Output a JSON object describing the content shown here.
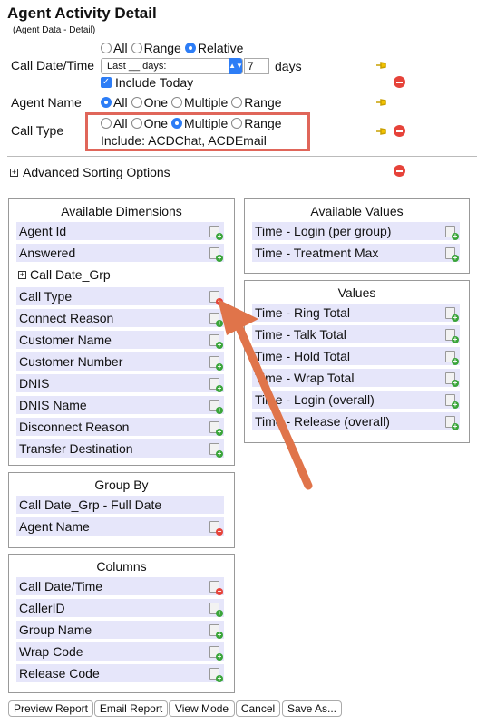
{
  "page": {
    "title": "Agent Activity Detail",
    "subtitle": "(Agent Data - Detail)"
  },
  "call_datetime": {
    "label": "Call Date/Time",
    "options": [
      "All",
      "Range",
      "Relative"
    ],
    "selected": "Relative",
    "dropdown_value": "Last __ days:",
    "days_value": "7",
    "days_unit": "days",
    "include_today_label": "Include Today",
    "include_today_checked": true
  },
  "agent_name": {
    "label": "Agent Name",
    "options": [
      "All",
      "One",
      "Multiple",
      "Range"
    ],
    "selected": "All"
  },
  "call_type": {
    "label": "Call Type",
    "options": [
      "All",
      "One",
      "Multiple",
      "Range"
    ],
    "selected": "Multiple",
    "include_text": "Include: ACDChat, ACDEmail"
  },
  "advanced_sorting": {
    "label": "Advanced Sorting Options"
  },
  "available_dimensions": {
    "title": "Available Dimensions",
    "items": [
      {
        "label": "Agent Id",
        "action": "add"
      },
      {
        "label": "Answered",
        "action": "add"
      },
      {
        "label": "Call Date_Grp",
        "action": "expand"
      },
      {
        "label": "Call Type",
        "action": "remove"
      },
      {
        "label": "Connect Reason",
        "action": "add"
      },
      {
        "label": "Customer Name",
        "action": "add"
      },
      {
        "label": "Customer Number",
        "action": "add"
      },
      {
        "label": "DNIS",
        "action": "add"
      },
      {
        "label": "DNIS Name",
        "action": "add"
      },
      {
        "label": "Disconnect Reason",
        "action": "add"
      },
      {
        "label": "Transfer Destination",
        "action": "add"
      }
    ]
  },
  "available_values": {
    "title": "Available Values",
    "items": [
      {
        "label": "Time - Login (per group)",
        "action": "add"
      },
      {
        "label": "Time - Treatment Max",
        "action": "add"
      }
    ]
  },
  "values": {
    "title": "Values",
    "items": [
      {
        "label": "Time - Ring Total",
        "action": "add"
      },
      {
        "label": "Time - Talk Total",
        "action": "add"
      },
      {
        "label": "Time - Hold Total",
        "action": "add"
      },
      {
        "label": "Time - Wrap Total",
        "action": "add"
      },
      {
        "label": "Time - Login (overall)",
        "action": "add"
      },
      {
        "label": "Time - Release (overall)",
        "action": "add"
      }
    ]
  },
  "group_by": {
    "title": "Group By",
    "items": [
      {
        "label": "Call Date_Grp - Full Date",
        "action": "none"
      },
      {
        "label": "Agent Name",
        "action": "remove"
      }
    ]
  },
  "columns": {
    "title": "Columns",
    "items": [
      {
        "label": "Call Date/Time",
        "action": "remove"
      },
      {
        "label": "CallerID",
        "action": "add"
      },
      {
        "label": "Group Name",
        "action": "add"
      },
      {
        "label": "Wrap Code",
        "action": "add"
      },
      {
        "label": "Release Code",
        "action": "add"
      }
    ]
  },
  "buttons": {
    "preview": "Preview Report",
    "email": "Email Report",
    "view_mode": "View Mode",
    "cancel": "Cancel",
    "save_as": "Save As..."
  },
  "colors": {
    "accent": "#2d7df6",
    "item_bg": "#e6e6fa",
    "highlight_box": "#e0665a",
    "arrow": "#e0744a"
  }
}
